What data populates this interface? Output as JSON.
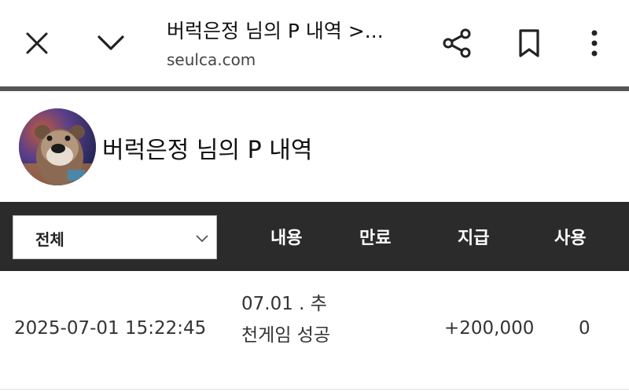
{
  "browser": {
    "tab_title": "버럭은정 님의 P 내역 >...",
    "url": "seulca.com",
    "icons": [
      "close-icon",
      "chevron-down-icon",
      "share-icon",
      "bookmark-icon",
      "more-vert-icon"
    ]
  },
  "profile": {
    "title": "버럭은정 님의 P 내역"
  },
  "table": {
    "filter": {
      "selected": "전체"
    },
    "headers": {
      "content": "내용",
      "expire": "만료",
      "paid": "지급",
      "used": "사용"
    },
    "rows": [
      {
        "datetime": "2025-07-01 15:22:45",
        "content": "07.01 . 추천게임 성공",
        "expire": "",
        "paid": "+200,000",
        "used": "0"
      }
    ]
  },
  "colors": {
    "header_band": "#2b2b2b",
    "divider": "#555555",
    "text": "#222222"
  }
}
